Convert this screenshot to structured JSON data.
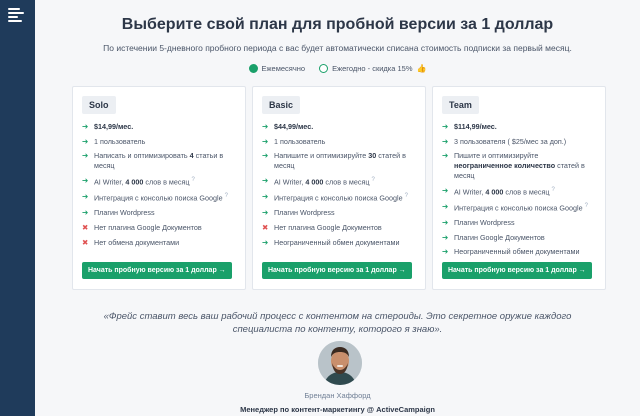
{
  "header": {
    "title": "Выберите свой план для пробной версии за 1 доллар",
    "subtitle": "По истечении 5-дневного пробного периода с вас будет автоматически списана стоимость подписки за первый месяц."
  },
  "billing": {
    "monthly_label": "Ежемесячно",
    "yearly_label": "Ежегодно - скидка 15%",
    "yearly_emoji": "👍",
    "selected": "monthly"
  },
  "plans": [
    {
      "name": "Solo",
      "price": "$14,99/мес.",
      "users": "1 пользователь",
      "write_pre": "Написать и оптимизировать ",
      "write_bold": "4",
      "write_post": " статьи в месяц",
      "ai_pre": "AI Writer, ",
      "ai_bold": "4 000",
      "ai_post": " слов в месяц",
      "gsc": "Интеграция с консолью поиска Google",
      "wordpress": "Плагин Wordpress",
      "gdocs": "Нет плагина Google Документов",
      "sharing": "Нет обмена документами",
      "cta": "Начать пробную версию за 1 доллар →"
    },
    {
      "name": "Basic",
      "price": "$44,99/мес.",
      "users": "1 пользователь",
      "write_pre": "Напишите и оптимизируйте ",
      "write_bold": "30",
      "write_post": " статей в месяц",
      "ai_pre": "AI Writer, ",
      "ai_bold": "4 000",
      "ai_post": " слов в месяц",
      "gsc": "Интеграция с консолью поиска Google",
      "wordpress": "Плагин Wordpress",
      "gdocs": "Нет плагина Google Документов",
      "sharing": "Неограниченный обмен документами",
      "cta": "Начать пробную версию за 1 доллар →"
    },
    {
      "name": "Team",
      "price": "$114,99/мес.",
      "users": "3 пользователя ( $25/мес за доп.)",
      "write_pre": "Пишите и оптимизируйте ",
      "write_bold": "неограниченное количество",
      "write_post": " статей в месяц",
      "ai_pre": "AI Writer, ",
      "ai_bold": "4 000",
      "ai_post": " слов в месяц",
      "gsc": "Интеграция с консолью поиска Google",
      "wordpress": "Плагин Wordpress",
      "gdocs": "Плагин Google Документов",
      "sharing": "Неограниченный обмен документами",
      "cta": "Начать пробную версию за 1 доллар →"
    }
  ],
  "icons": {
    "ok": "check-arrow-icon",
    "no": "cross-icon",
    "help": "question-icon"
  },
  "colors": {
    "sidebar": "#1f3b5b",
    "accent": "#1aa06a",
    "negative": "#e05252"
  },
  "testimonial": {
    "quote": "«Фрейс ставит весь ваш рабочий процесс с контентом на стероиды. Это секретное оружие каждого специалиста по контенту, которого я знаю».",
    "author": "Брендан Хаффорд",
    "role": "Менеджер по контент-маркетингу @ ActiveCampaign"
  }
}
